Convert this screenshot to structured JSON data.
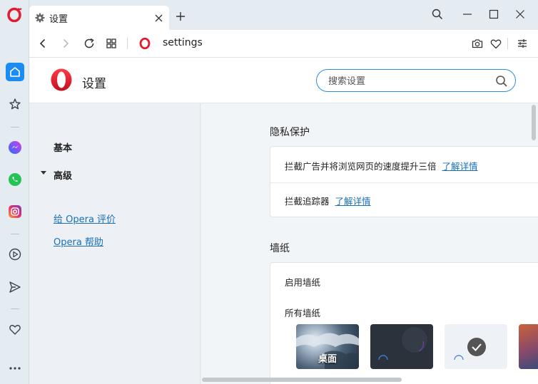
{
  "browser": {
    "tab_title": "设置",
    "url": "settings"
  },
  "settings": {
    "title": "设置",
    "search_placeholder": "搜索设置",
    "nav": {
      "basic": "基本",
      "advanced": "高级",
      "rate_opera": "给 Opera 评价",
      "opera_help": "Opera 帮助"
    },
    "privacy": {
      "title": "隐私保护",
      "block_ads": "拦截广告并将浏览网页的速度提升三倍",
      "block_ads_link": "了解详情",
      "block_trackers": "拦截追踪器",
      "block_trackers_link": "了解详情"
    },
    "wallpaper": {
      "title": "墙纸",
      "enable": "启用墙纸",
      "all": "所有墙纸",
      "desktop_label": "桌面"
    }
  },
  "colors": {
    "opera_red": "#e21b2e",
    "accent_blue": "#1b8cf2",
    "link_blue": "#1a6fb5"
  }
}
